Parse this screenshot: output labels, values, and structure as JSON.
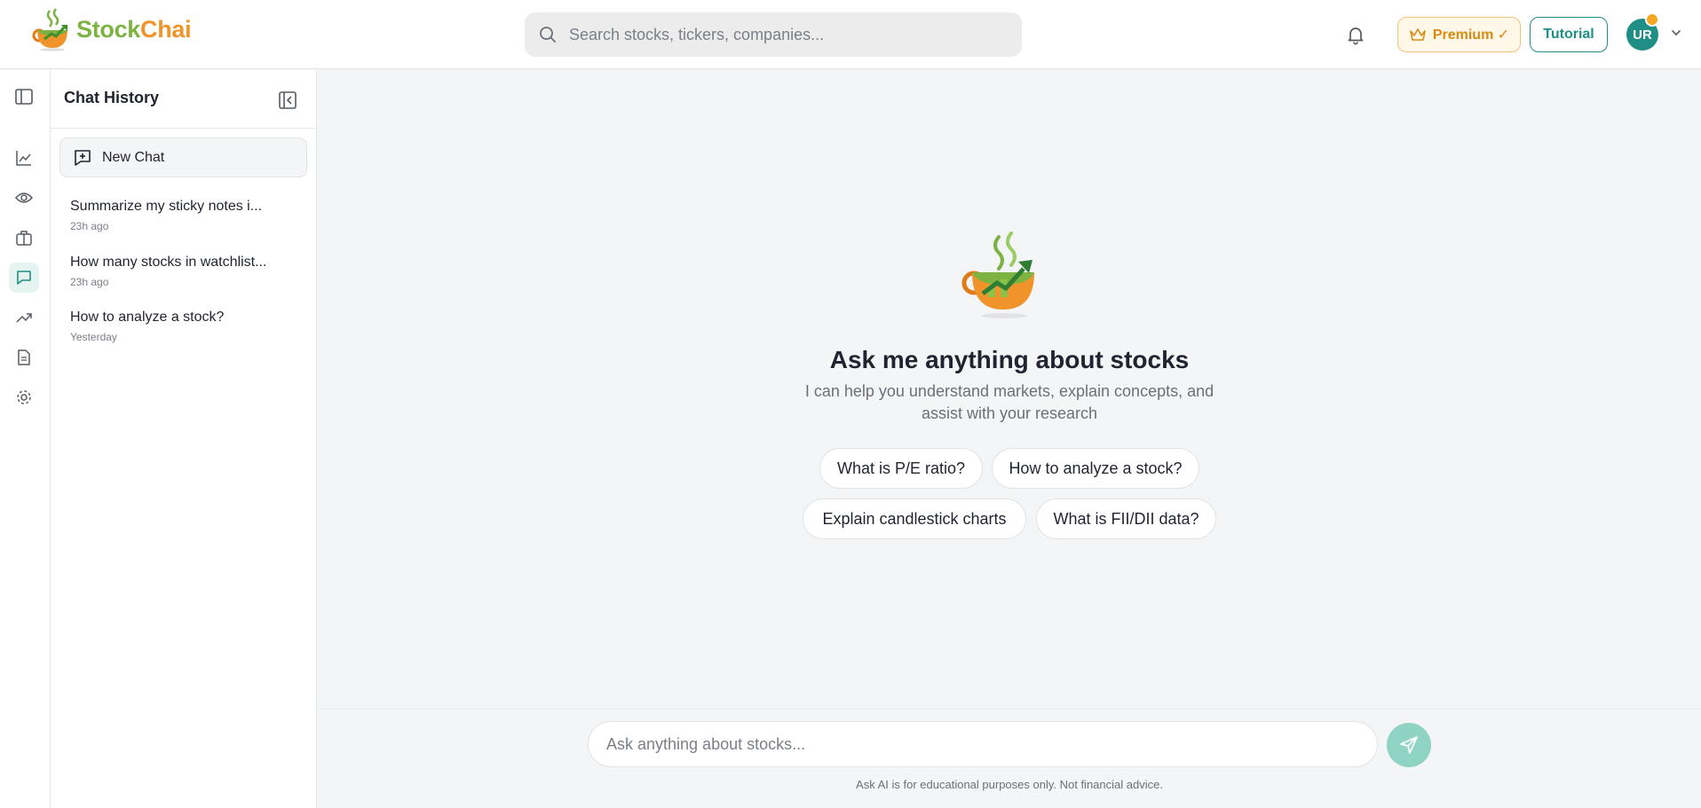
{
  "brand": {
    "name_part1": "Stock",
    "name_part2": "Chai",
    "colors": {
      "green": "#7cb342",
      "orange": "#f0932b",
      "teal": "#1f8f86"
    }
  },
  "header": {
    "search_placeholder": "Search stocks, tickers, companies...",
    "premium_label": "Premium ✓",
    "tutorial_label": "Tutorial",
    "avatar_initials": "UR"
  },
  "rail": {
    "items": [
      "sidebar-toggle-icon",
      "chart-line-icon",
      "eye-icon",
      "briefcase-icon",
      "chat-icon",
      "trending-up-icon",
      "document-icon",
      "gear-icon"
    ],
    "active": "chat-icon"
  },
  "history": {
    "title": "Chat History",
    "new_chat_label": "New Chat",
    "items": [
      {
        "title": "Summarize my sticky notes i...",
        "time": "23h ago"
      },
      {
        "title": "How many stocks in watchlist...",
        "time": "23h ago"
      },
      {
        "title": "How to analyze a stock?",
        "time": "Yesterday"
      }
    ]
  },
  "main": {
    "title": "Ask me anything about stocks",
    "subtitle": "I can help you understand markets, explain concepts, and assist with your research",
    "suggestions": [
      "What is P/E ratio?",
      "How to analyze a stock?",
      "Explain candlestick charts",
      "What is FII/DII data?"
    ],
    "input_placeholder": "Ask anything about stocks...",
    "disclaimer": "Ask AI is for educational purposes only. Not financial advice."
  }
}
